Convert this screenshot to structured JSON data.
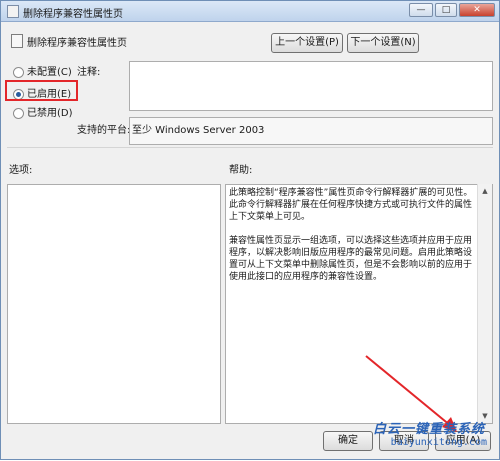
{
  "window": {
    "title": "删除程序兼容性属性页",
    "controls": {
      "minimize": "—",
      "maximize": "□",
      "close": "✕"
    }
  },
  "header": {
    "title": "删除程序兼容性属性页",
    "prev_label": "上一个设置(P)",
    "next_label": "下一个设置(N)"
  },
  "state": {
    "options": [
      {
        "label": "未配置(C)",
        "selected": false
      },
      {
        "label": "已启用(E)",
        "selected": true
      },
      {
        "label": "已禁用(D)",
        "selected": false
      }
    ]
  },
  "comment": {
    "label": "注释:"
  },
  "platform": {
    "label": "支持的平台:",
    "value": "至少 Windows Server 2003"
  },
  "options_panel": {
    "label": "选项:"
  },
  "help_panel": {
    "label": "帮助:",
    "paragraphs": [
      "此策略控制“程序兼容性”属性页命令行解释器扩展的可见性。此命令行解释器扩展在任何程序快捷方式或可执行文件的属性上下文菜单上可见。",
      "兼容性属性页显示一组选项，可以选择这些选项并应用于应用程序，以解决影响旧版应用程序的最常见问题。启用此策略设置可从上下文菜单中删除属性页，但是不会影响以前的应用于使用此接口的应用程序的兼容性设置。"
    ]
  },
  "footer": {
    "ok_label": "确定",
    "cancel_label": "取消",
    "apply_label": "应用(A)"
  },
  "watermark": {
    "text": "白云一键重装系统",
    "url": "baiyunxitong.com"
  },
  "colors": {
    "highlight": "#e3262a",
    "arrow": "#e3262a",
    "watermark": "#2b63b7"
  }
}
